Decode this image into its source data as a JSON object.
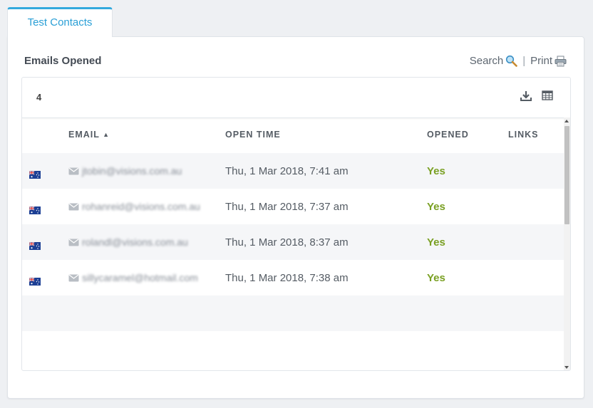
{
  "tab": {
    "label": "Test Contacts"
  },
  "section": {
    "title": "Emails Opened"
  },
  "tools": {
    "search_label": "Search",
    "separator": "|",
    "print_label": "Print"
  },
  "card": {
    "count": "4"
  },
  "table": {
    "columns": {
      "email": "EMAIL",
      "sort_indicator": "▲",
      "open_time": "OPEN TIME",
      "opened": "OPENED",
      "links": "LINKS"
    },
    "rows": [
      {
        "country": "australia-flag-icon",
        "email": "jtobin@visions.com.au",
        "open_time": "Thu, 1 Mar 2018, 7:41 am",
        "opened": "Yes",
        "links": ""
      },
      {
        "country": "australia-flag-icon",
        "email": "rohanreid@visions.com.au",
        "open_time": "Thu, 1 Mar 2018, 7:37 am",
        "opened": "Yes",
        "links": ""
      },
      {
        "country": "australia-flag-icon",
        "email": "rolandl@visions.com.au",
        "open_time": "Thu, 1 Mar 2018, 8:37 am",
        "opened": "Yes",
        "links": ""
      },
      {
        "country": "australia-flag-icon",
        "email": "sillycaramel@hotmail.com",
        "open_time": "Thu, 1 Mar 2018, 7:38 am",
        "opened": "Yes",
        "links": ""
      }
    ]
  },
  "colors": {
    "accent": "#33a9dd",
    "opened_yes": "#7aa023"
  }
}
